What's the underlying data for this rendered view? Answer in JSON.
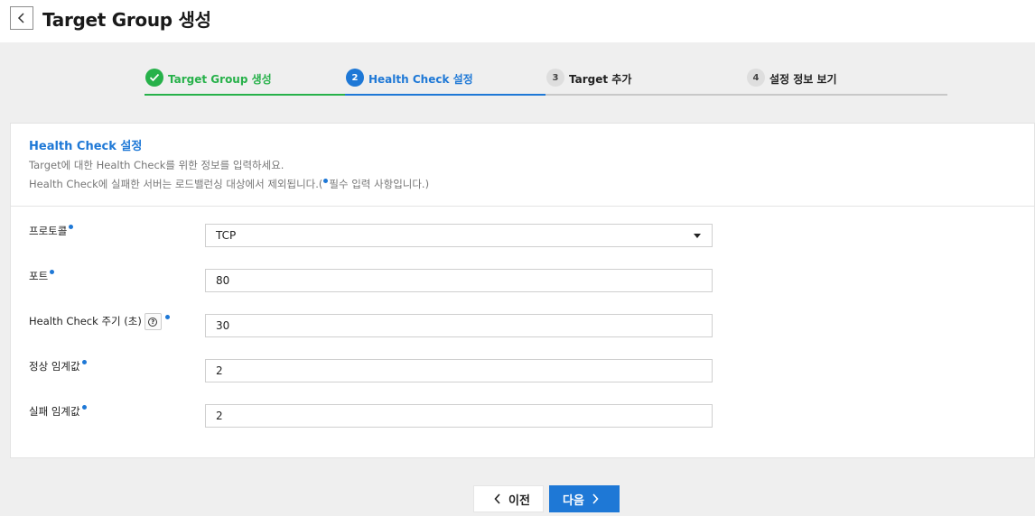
{
  "header": {
    "title": "Target Group 생성"
  },
  "steps": [
    {
      "number": "1",
      "label": "Target Group 생성",
      "state": "done"
    },
    {
      "number": "2",
      "label": "Health Check 설정",
      "state": "active"
    },
    {
      "number": "3",
      "label": "Target 추가",
      "state": "todo"
    },
    {
      "number": "4",
      "label": "설정 정보 보기",
      "state": "todo"
    }
  ],
  "section": {
    "title": "Health Check 설정",
    "description_1": "Target에 대한 Health Check를 위한 정보를 입력하세요.",
    "description_2_prefix": "Health Check에 실패한 서버는 로드밸런싱 대상에서 제외됩니다.(",
    "description_2_suffix": "필수 입력 사항입니다.)"
  },
  "form": {
    "protocol": {
      "label": "프로토콜",
      "value": "TCP"
    },
    "port": {
      "label": "포트",
      "value": "80"
    },
    "interval": {
      "label": "Health Check 주기 (초)",
      "value": "30"
    },
    "healthy_threshold": {
      "label": "정상 임계값",
      "value": "2"
    },
    "unhealthy_threshold": {
      "label": "실패 임계값",
      "value": "2"
    }
  },
  "buttons": {
    "prev_label": "이전",
    "next_label": "다음"
  },
  "icons": {
    "back": "chevron-left-icon",
    "check": "check-icon",
    "help": "question-icon",
    "caret": "caret-down-icon"
  },
  "colors": {
    "accent": "#1e78d6",
    "success": "#27b14a"
  }
}
